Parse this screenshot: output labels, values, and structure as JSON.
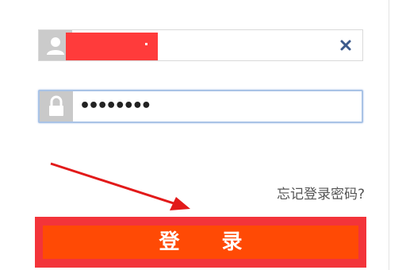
{
  "form": {
    "username": {
      "value": "",
      "icon": "user-icon",
      "clear_icon": "close-icon"
    },
    "password": {
      "value": "••••••••",
      "icon": "lock-icon"
    },
    "forgot_link": "忘记登录密码?",
    "login_label": "登 录"
  },
  "colors": {
    "accent": "#ff4a05",
    "button_frame": "#f3343a",
    "redaction": "#ff3b3b",
    "focus_border": "#a9c3e6",
    "annotation_arrow": "#e21a1a"
  }
}
